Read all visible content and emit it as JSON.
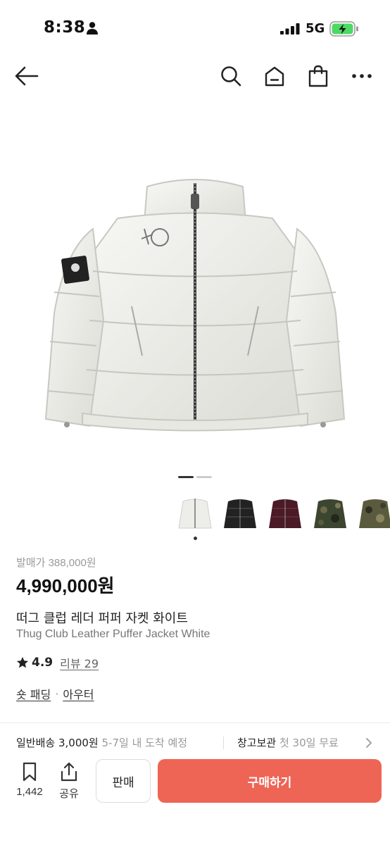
{
  "status_bar": {
    "time": "8:38",
    "network": "5G"
  },
  "nav": {
    "icons": [
      "back-arrow-icon",
      "search-icon",
      "home-icon",
      "shopping-bag-icon",
      "more-icon"
    ]
  },
  "gallery": {
    "total_pages": 2,
    "current_page": 1,
    "thumbnails": [
      {
        "name": "white",
        "color": "#e9e9e4"
      },
      {
        "name": "black",
        "color": "#1f1f1f"
      },
      {
        "name": "burgundy",
        "color": "#4a1a26"
      },
      {
        "name": "camo",
        "color": "#3c4530"
      },
      {
        "name": "camo2",
        "color": "#5a5a3e"
      }
    ]
  },
  "product": {
    "msrp_label": "발매가 388,000원",
    "price": "4,990,000원",
    "name_ko": "떠그 클럽 레더 퍼퍼 자켓 화이트",
    "name_en": "Thug Club Leather Puffer Jacket White",
    "rating": "4.9",
    "review_label": "리뷰 29",
    "category_1": "숏 패딩",
    "category_sep": "·",
    "category_2": "아우터"
  },
  "shipping": {
    "label": "일반배송 3,000원",
    "eta": "5-7일 내 도착 예정"
  },
  "storage": {
    "label": "창고보관",
    "promo": "첫 30일 무료"
  },
  "actions": {
    "like_count": "1,442",
    "share_label": "공유",
    "sell_label": "판매",
    "buy_label": "구매하기"
  },
  "colors": {
    "buy_button": "#ee6556",
    "muted_text": "#999999"
  }
}
